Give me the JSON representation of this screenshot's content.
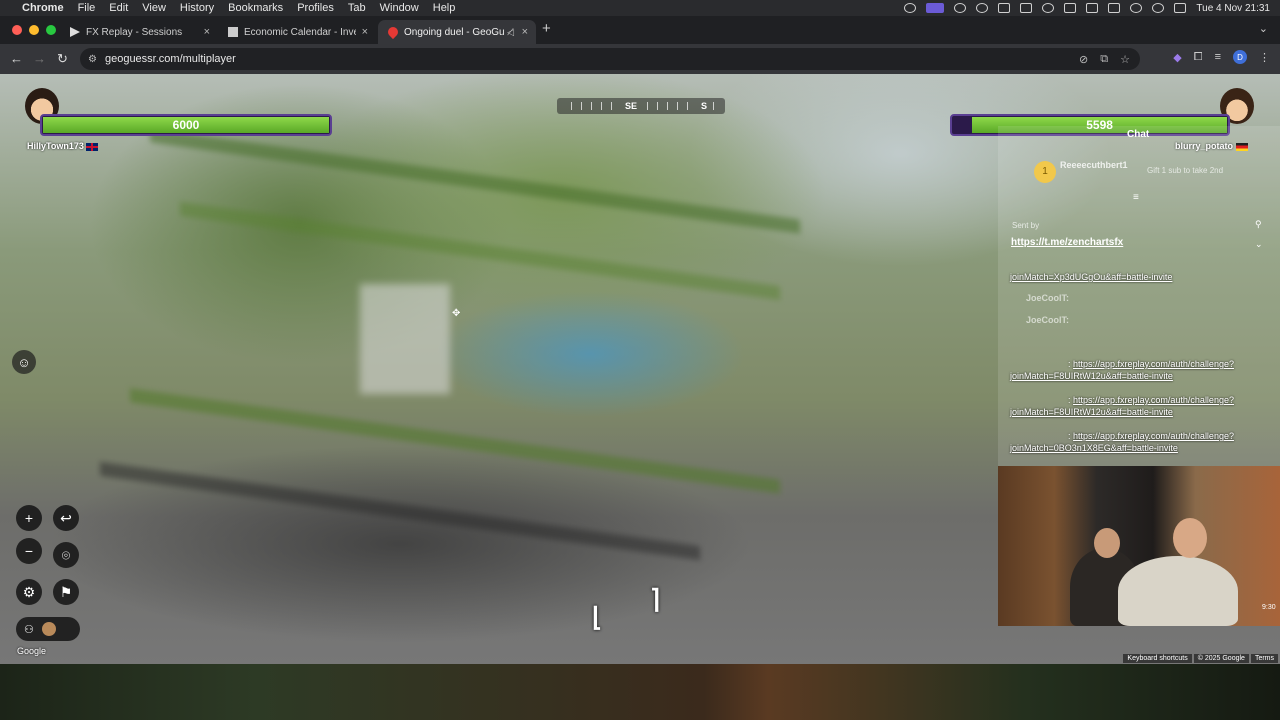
{
  "menubar": {
    "app": "Chrome",
    "items": [
      "File",
      "Edit",
      "View",
      "History",
      "Bookmarks",
      "Profiles",
      "Tab",
      "Window",
      "Help"
    ],
    "datetime": "Tue 4 Nov  21:31"
  },
  "tabs": [
    {
      "title": "FX Replay - Sessions",
      "icon": "fxreplay-icon"
    },
    {
      "title": "Economic Calendar - Investin",
      "icon": "investing-icon"
    },
    {
      "title": "Ongoing duel - GeoGuess",
      "icon": "geoguessr-pin-icon"
    }
  ],
  "toolbar": {
    "url": "geoguessr.com/multiplayer",
    "profile_initial": "D"
  },
  "game": {
    "compass": {
      "labels": [
        "SE",
        "S"
      ]
    },
    "player_left": {
      "name": "HillyTown173",
      "health": "6000",
      "health_fraction": 1.0
    },
    "player_right": {
      "name": "blurry_potato",
      "health": "5598",
      "health_fraction": 0.93
    },
    "google_label": "Google",
    "keyboard_shortcuts": "Keyboard shortcuts",
    "copyright": "© 2025 Google",
    "terms": "Terms"
  },
  "chat": {
    "title": "Chat",
    "donation_rank": "1",
    "donation_user": "Reeeecuthbert1",
    "gift_text": "Gift 1 sub to take 2nd",
    "sent_by_label": "Sent by",
    "pinned_link": "https://t.me/zenchartsfx",
    "messages": [
      {
        "user": "",
        "text": "joinMatch=Xp3dUGgOu&aff=battle-invite",
        "link": true
      },
      {
        "user": "JoeCoolT:",
        "text": "",
        "link": false
      },
      {
        "user": "JoeCoolT:",
        "text": "",
        "link": false
      },
      {
        "user": ":",
        "text": "https://app.fxreplay.com/auth/challenge?joinMatch=F8UIRtW12u&aff=battle-invite",
        "link": true
      },
      {
        "user": ":",
        "text": "https://app.fxreplay.com/auth/challenge?joinMatch=F8UIRtW12u&aff=battle-invite",
        "link": true
      },
      {
        "user": ":",
        "text": "https://app.fxreplay.com/auth/challenge?joinMatch=0BO3n1X8EG&aff=battle-invite",
        "link": true
      }
    ]
  },
  "webcam": {
    "timestamp": "9:30"
  },
  "colors": {
    "health_green": "#6cc135",
    "health_border": "#5a3f92",
    "link": "#ffffff"
  }
}
